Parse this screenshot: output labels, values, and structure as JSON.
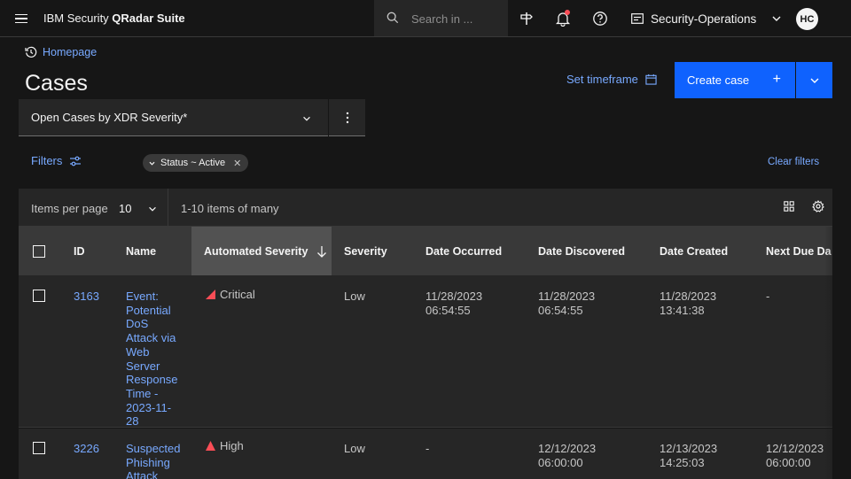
{
  "header": {
    "brand_prefix": "IBM Security ",
    "brand_bold": "QRadar Suite",
    "search_placeholder": "Search in ...",
    "workspace": "Security-Operations",
    "avatar_initials": "HC"
  },
  "page": {
    "breadcrumb": "Homepage",
    "title": "Cases",
    "timeframe_label": "Set timeframe",
    "create_label": "Create case",
    "create_plus": "+"
  },
  "view": {
    "selected": "Open Cases by XDR Severity*"
  },
  "filters": {
    "label": "Filters",
    "tag": "Status ~ Active",
    "clear": "Clear filters"
  },
  "toolbar": {
    "items_per_page_label": "Items per page",
    "items_per_page_value": "10",
    "range_text": "1-10 items of many"
  },
  "table": {
    "columns": [
      "ID",
      "Name",
      "Automated Severity",
      "Severity",
      "Date Occurred",
      "Date Discovered",
      "Date Created",
      "Next Due Da"
    ],
    "rows": [
      {
        "id": "3163",
        "name_lines": [
          "Event:",
          "Potential",
          "DoS",
          "Attack via",
          "Web",
          "Server",
          "Response",
          "Time -",
          "2023-11-",
          "28"
        ],
        "auto_severity": "Critical",
        "severity": "Low",
        "occurred": [
          "11/28/2023",
          "06:54:55"
        ],
        "discovered": [
          "11/28/2023",
          "06:54:55"
        ],
        "created": [
          "11/28/2023",
          "13:41:38"
        ],
        "next_due": [
          "-"
        ]
      },
      {
        "id": "3226",
        "name_lines": [
          "Suspected",
          "Phishing",
          "Attack"
        ],
        "auto_severity": "High",
        "severity": "Low",
        "occurred": [
          "-"
        ],
        "discovered": [
          "12/12/2023",
          "06:00:00"
        ],
        "created": [
          "12/13/2023",
          "14:25:03"
        ],
        "next_due": [
          "12/12/2023",
          "06:00:00"
        ]
      }
    ]
  },
  "colors": {
    "accent": "#0f62fe",
    "link": "#78a9ff",
    "critical": "#fa4d56",
    "high": "#ff8389"
  }
}
